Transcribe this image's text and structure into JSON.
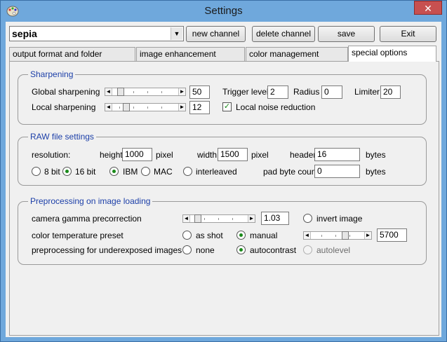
{
  "window": {
    "title": "Settings",
    "close_symbol": "✕"
  },
  "toolbar": {
    "channel_value": "sepia",
    "new_channel_label": "new channel",
    "delete_channel_label": "delete channel",
    "save_label": "save",
    "exit_label": "Exit"
  },
  "tabs": [
    {
      "label": "output format and folder"
    },
    {
      "label": "image enhancement"
    },
    {
      "label": "color management"
    },
    {
      "label": "special options",
      "active": true
    }
  ],
  "sharpening": {
    "title": "Sharpening",
    "global_label": "Global sharpening",
    "global_value": "50",
    "local_label": "Local sharpening",
    "local_value": "12",
    "trigger_label": "Trigger level",
    "trigger_value": "2",
    "radius_label": "Radius",
    "radius_value": "0",
    "limiter_label": "Limiter",
    "limiter_value": "20",
    "local_noise_label": "Local noise reduction",
    "local_noise_checked": true
  },
  "raw": {
    "title": "RAW file settings",
    "resolution_label": "resolution:",
    "height_label": "height",
    "height_value": "1000",
    "height_unit": "pixel",
    "width_label": "width",
    "width_value": "1500",
    "width_unit": "pixel",
    "header_label": "header",
    "header_value": "16",
    "header_unit": "bytes",
    "bit8_label": "8 bit",
    "bit16_label": "16 bit",
    "ibm_label": "IBM",
    "mac_label": "MAC",
    "interleaved_label": "interleaved",
    "pad_label": "pad byte count",
    "pad_value": "0",
    "pad_unit": "bytes"
  },
  "preprocessing": {
    "title": "Preprocessing on image loading",
    "gamma_label": "camera gamma precorrection",
    "gamma_value": "1.03",
    "invert_label": "invert image",
    "color_temp_label": "color temperature preset",
    "as_shot_label": "as shot",
    "manual_label": "manual",
    "color_temp_value": "5700",
    "underexposed_label": "preprocessing for underexposed images",
    "none_label": "none",
    "autocontrast_label": "autocontrast",
    "autolevel_label": "autolevel"
  },
  "icons": {
    "app_icon": "palette-icon",
    "dropdown_arrow": "▼",
    "slider_left": "◄",
    "slider_right": "►",
    "check": "✓"
  },
  "colors": {
    "titlebar": "#6fa8dc",
    "group_title": "#1c3fa8",
    "radio_dot": "#1a8a1a",
    "close_button": "#c75050"
  }
}
